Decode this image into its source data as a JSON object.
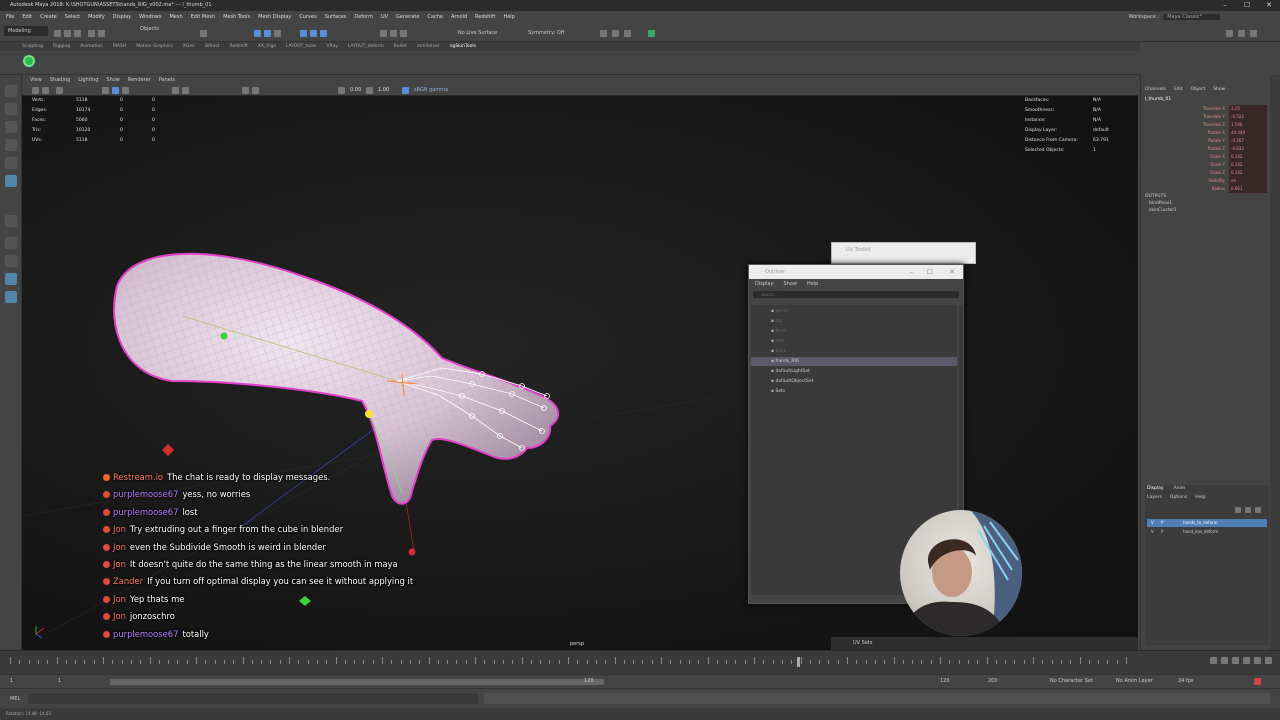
{
  "window": {
    "title": "Autodesk Maya 2018: K:\\SHOTGUN\\ASSETS\\hands_RIG_v002.ma* --- l_thumb_01",
    "minimize": "–",
    "maximize": "☐",
    "close": "✕"
  },
  "menubar": {
    "items": [
      "File",
      "Edit",
      "Create",
      "Select",
      "Modify",
      "Display",
      "Windows",
      "Mesh",
      "Edit Mesh",
      "Mesh Tools",
      "Mesh Display",
      "Curves",
      "Surfaces",
      "Deform",
      "UV",
      "Generate",
      "Cache",
      "Arnold",
      "Redshift",
      "Help"
    ],
    "workspace_label": "Workspace :",
    "workspace_value": "Maya Classic*"
  },
  "statusline": {
    "mode": "Modeling",
    "objects_label": "Objects",
    "live_surface": "No Live Surface",
    "symmetry": "Symmetry: Off"
  },
  "shelf": {
    "tabs": [
      "Sculpting",
      "Rigging",
      "Animation",
      "MASH",
      "Motion Graphics",
      "XGen",
      "Bifrost",
      "Redshift",
      "XX_Rigs",
      "LAYOUT_tools",
      "VRay",
      "LAYOUT_deform",
      "Bullet",
      "mmSolver",
      "ngSkinTools"
    ],
    "active_tab": "ngSkinTools"
  },
  "viewport": {
    "menu": [
      "View",
      "Shading",
      "Lighting",
      "Show",
      "Renderer",
      "Panels"
    ],
    "field_a": "0.00",
    "field_b": "1.00",
    "colorspace": "sRGB gamma",
    "camera": "persp",
    "hud_left": [
      {
        "label": "Verts:",
        "a": "5118",
        "b": "0",
        "c": "0"
      },
      {
        "label": "Edges:",
        "a": "10174",
        "b": "0",
        "c": "0"
      },
      {
        "label": "Faces:",
        "a": "5060",
        "b": "0",
        "c": "0"
      },
      {
        "label": "Tris:",
        "a": "10120",
        "b": "0",
        "c": "0"
      },
      {
        "label": "UVs:",
        "a": "5118",
        "b": "0",
        "c": "0"
      }
    ],
    "hud_right": [
      {
        "label": "Backfaces:",
        "value": "N/A"
      },
      {
        "label": "Smoothness:",
        "value": "N/A"
      },
      {
        "label": "Instance:",
        "value": "N/A"
      },
      {
        "label": "Display Layer:",
        "value": "default"
      },
      {
        "label": "Distance From Camera:",
        "value": "63.791"
      },
      {
        "label": "Selected Objects:",
        "value": "1"
      }
    ]
  },
  "chat": [
    {
      "user": "Restream.io",
      "message": "The chat is ready to display messages.",
      "color": "#ff7a6a",
      "dot": "#f26a2d"
    },
    {
      "user": "purplemoose67",
      "message": "yess, no worries",
      "color": "#b97cff",
      "dot": "#e14b3b"
    },
    {
      "user": "purplemoose67",
      "message": "lost",
      "color": "#b97cff",
      "dot": "#e14b3b"
    },
    {
      "user": "Jon",
      "message": "Try extruding out a finger from the cube in blender",
      "color": "#ff7a6a",
      "dot": "#e14b3b"
    },
    {
      "user": "Jon",
      "message": "even the Subdivide Smooth is weird in blender",
      "color": "#ff7a6a",
      "dot": "#e14b3b"
    },
    {
      "user": "Jon",
      "message": "It doesn't quite do the same thing as the linear smooth in maya",
      "color": "#ff7a6a",
      "dot": "#e14b3b"
    },
    {
      "user": "Zander",
      "message": "If you turn off optimal display you can see it without applying it",
      "color": "#ff7a6a",
      "dot": "#e14b3b"
    },
    {
      "user": "Jon",
      "message": "Yep thats me",
      "color": "#ff7a6a",
      "dot": "#e14b3b"
    },
    {
      "user": "Jon",
      "message": "jonzoschro",
      "color": "#ff7a6a",
      "dot": "#e14b3b"
    },
    {
      "user": "purplemoose67",
      "message": "totally",
      "color": "#b97cff",
      "dot": "#e14b3b"
    }
  ],
  "uv_toolkit": {
    "title": "UV Toolkit"
  },
  "outliner": {
    "title": "Outliner",
    "menu": [
      "Display",
      "Show",
      "Help"
    ],
    "search_placeholder": "Search...",
    "items": [
      {
        "label": "persp",
        "dim": true
      },
      {
        "label": "top",
        "dim": true
      },
      {
        "label": "front",
        "dim": true
      },
      {
        "label": "side",
        "dim": true
      },
      {
        "label": "back",
        "dim": true
      },
      {
        "label": "hands_RIG",
        "dim": false,
        "highlight": true
      },
      {
        "label": "defaultLightSet",
        "dim": false
      },
      {
        "label": "defaultObjectSet",
        "dim": false
      },
      {
        "label": "Sets",
        "dim": false
      }
    ]
  },
  "uv_sets": {
    "label": "UV Sets"
  },
  "channel_box": {
    "menu": [
      "Channels",
      "Edit",
      "Object",
      "Show"
    ],
    "object": "l_thumb_01",
    "attributes": [
      {
        "name": "Translate X",
        "value": "3.25"
      },
      {
        "name": "Translate Y",
        "value": "-0.522"
      },
      {
        "name": "Translate Z",
        "value": "1.546"
      },
      {
        "name": "Rotate X",
        "value": "44.449"
      },
      {
        "name": "Rotate Y",
        "value": "-0.267"
      },
      {
        "name": "Rotate Z",
        "value": "-0.832"
      },
      {
        "name": "Scale X",
        "value": "0.242"
      },
      {
        "name": "Scale Y",
        "value": "0.242"
      },
      {
        "name": "Scale Z",
        "value": "0.242"
      },
      {
        "name": "Visibility",
        "value": "on"
      },
      {
        "name": "Radius",
        "value": "0.661"
      }
    ],
    "outputs_title": "OUTPUTS",
    "outputs": [
      "bindPose1",
      "skinCluster1"
    ]
  },
  "layer_editor": {
    "tabs": [
      "Display",
      "Anim"
    ],
    "menu": [
      "Layers",
      "Options",
      "Help"
    ],
    "layers": [
      {
        "vis": "V",
        "ref": "P",
        "name": "hands_to_deform",
        "highlight": true
      },
      {
        "vis": "V",
        "ref": "P",
        "name": "hand_low_deform",
        "highlight": false
      }
    ]
  },
  "timeline": {
    "start": "1",
    "start_inner": "1",
    "range_end_inner": "120",
    "range_end": "120",
    "anim_end": "200",
    "character_set": "No Character Set",
    "anim_layer": "No Anim Layer",
    "fps": "24 fps"
  },
  "command_line": {
    "language": "MEL"
  },
  "help_line": {
    "text": "Rotation: 14.48    -14.03"
  },
  "colors": {
    "accent": "#5285a6",
    "wireframe": "#e040c8",
    "mesh": "#d8c0d8"
  }
}
